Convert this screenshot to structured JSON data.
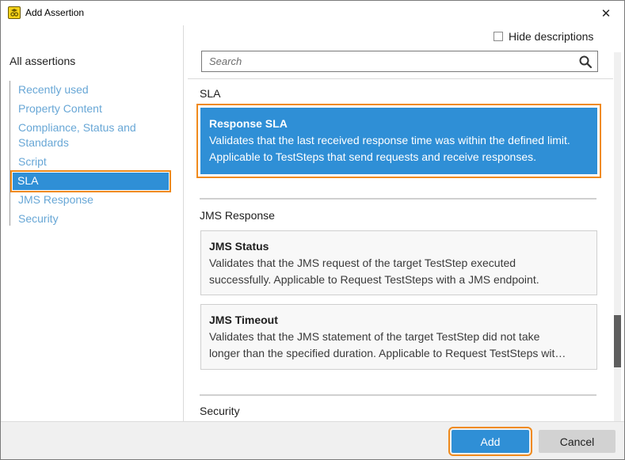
{
  "window": {
    "title": "Add Assertion",
    "close_glyph": "✕"
  },
  "sidebar": {
    "heading": "All assertions",
    "items": [
      {
        "label": "Recently used"
      },
      {
        "label": "Property Content"
      },
      {
        "label": "Compliance, Status and Standards"
      },
      {
        "label": "Script"
      },
      {
        "label": "SLA"
      },
      {
        "label": "JMS Response"
      },
      {
        "label": "Security"
      }
    ],
    "selected": "SLA"
  },
  "options": {
    "hide_descriptions_label": "Hide descriptions",
    "hide_descriptions_checked": false
  },
  "search": {
    "placeholder": "Search"
  },
  "sections": [
    {
      "title": "SLA",
      "cards": [
        {
          "title": "Response SLA",
          "description": "Validates that the last received response time was within the defined limit. Applicable to TestSteps that send requests and receive responses.",
          "selected": true
        }
      ]
    },
    {
      "title": "JMS Response",
      "cards": [
        {
          "title": "JMS Status",
          "description_lines": [
            "Validates that the JMS request of the target TestStep executed",
            "successfully. Applicable to Request TestSteps with a JMS endpoint."
          ]
        },
        {
          "title": "JMS Timeout",
          "description_lines": [
            "Validates that the JMS statement of the target TestStep did not take",
            "longer than the specified duration. Applicable to Request TestSteps wit…"
          ]
        }
      ]
    },
    {
      "title": "Security",
      "cards": []
    }
  ],
  "footer": {
    "add_label": "Add",
    "cancel_label": "Cancel"
  },
  "colors": {
    "accent": "#2f8fd6",
    "highlight_outline": "#f08a1c",
    "link_text": "#68a7d6"
  },
  "icons": {
    "app": "soapui-app-icon",
    "close": "close-icon",
    "search": "search-icon",
    "checkbox": "checkbox-icon"
  }
}
